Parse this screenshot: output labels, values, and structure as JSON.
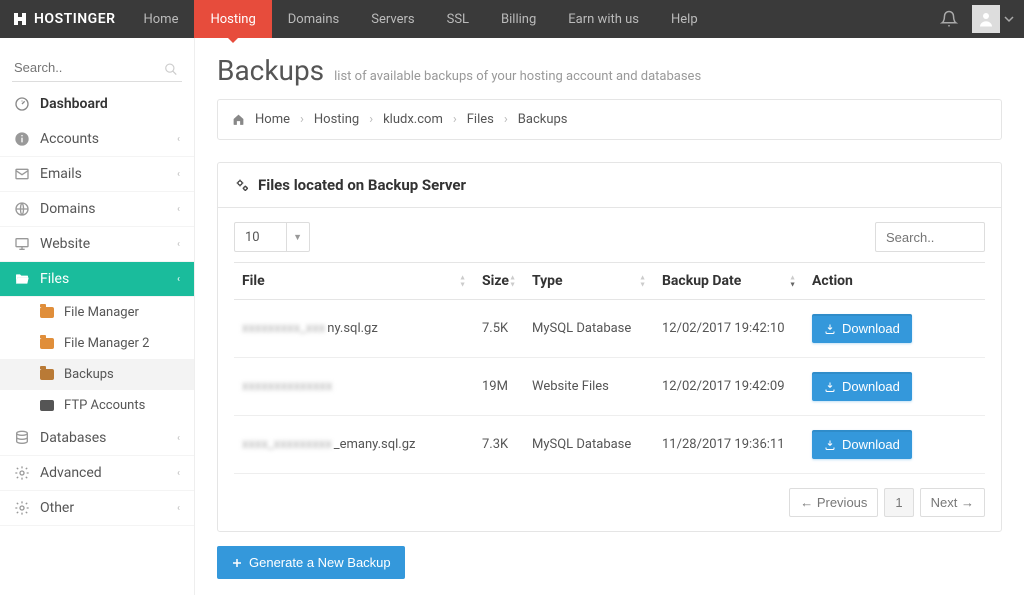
{
  "brand": "HOSTINGER",
  "nav": [
    {
      "label": "Home"
    },
    {
      "label": "Hosting",
      "active": true
    },
    {
      "label": "Domains"
    },
    {
      "label": "Servers"
    },
    {
      "label": "SSL"
    },
    {
      "label": "Billing"
    },
    {
      "label": "Earn with us"
    },
    {
      "label": "Help"
    }
  ],
  "sidebar_search_placeholder": "Search..",
  "sidebar": {
    "dashboard": "Dashboard",
    "items": [
      {
        "label": "Accounts",
        "icon": "info"
      },
      {
        "label": "Emails",
        "icon": "mail"
      },
      {
        "label": "Domains",
        "icon": "globe"
      },
      {
        "label": "Website",
        "icon": "monitor"
      },
      {
        "label": "Files",
        "icon": "folder-open",
        "active": true,
        "subs": [
          {
            "label": "File Manager",
            "icon": "folder"
          },
          {
            "label": "File Manager 2",
            "icon": "folder"
          },
          {
            "label": "Backups",
            "icon": "folder-alt",
            "current": true
          },
          {
            "label": "FTP Accounts",
            "icon": "terminal"
          }
        ]
      },
      {
        "label": "Databases",
        "icon": "database"
      },
      {
        "label": "Advanced",
        "icon": "gear"
      },
      {
        "label": "Other",
        "icon": "gear"
      }
    ]
  },
  "page": {
    "title": "Backups",
    "subtitle": "list of available backups of your hosting account and databases"
  },
  "breadcrumb": [
    "Home",
    "Hosting",
    "kludx.com",
    "Files",
    "Backups"
  ],
  "panel_title": "Files located on Backup Server",
  "page_size": "10",
  "table_search_placeholder": "Search..",
  "columns": [
    "File",
    "Size",
    "Type",
    "Backup Date",
    "Action"
  ],
  "rows": [
    {
      "file_hidden": "xxxxxxxxx_xxx",
      "file_suffix": "ny.sql.gz",
      "size": "7.5K",
      "type": "MySQL Database",
      "date": "12/02/2017 19:42:10"
    },
    {
      "file_hidden": "xxxxxxxxxxxxxx",
      "file_suffix": "",
      "size": "19M",
      "type": "Website Files",
      "date": "12/02/2017 19:42:09"
    },
    {
      "file_hidden": "xxxx_xxxxxxxxx",
      "file_suffix": "_emany.sql.gz",
      "size": "7.3K",
      "type": "MySQL Database",
      "date": "11/28/2017 19:36:11"
    }
  ],
  "download_label": "Download",
  "pagination": {
    "prev": "← Previous",
    "page": "1",
    "next": "Next →"
  },
  "generate_label": "Generate a New Backup"
}
